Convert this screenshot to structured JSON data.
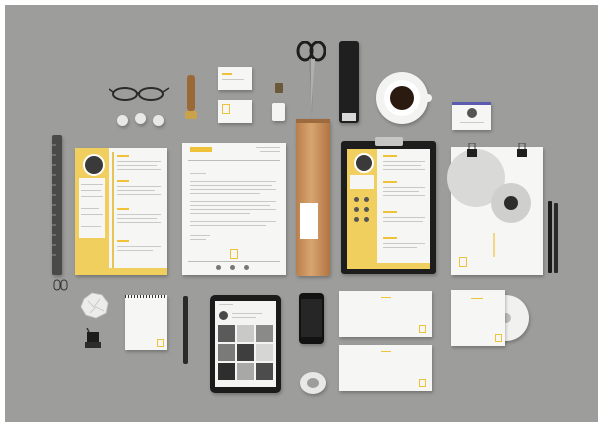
{
  "scene": {
    "description_type": "stationery-mockup-flatlay",
    "colors": {
      "background": "#9d9d9b",
      "accent_yellow": "#f0c23a",
      "paper": "#f6f6f4",
      "dark": "#262626"
    }
  },
  "resume_left": {
    "name_label": "",
    "sections": [
      "",
      "",
      "",
      ""
    ]
  },
  "letterhead": {
    "tag": ""
  }
}
